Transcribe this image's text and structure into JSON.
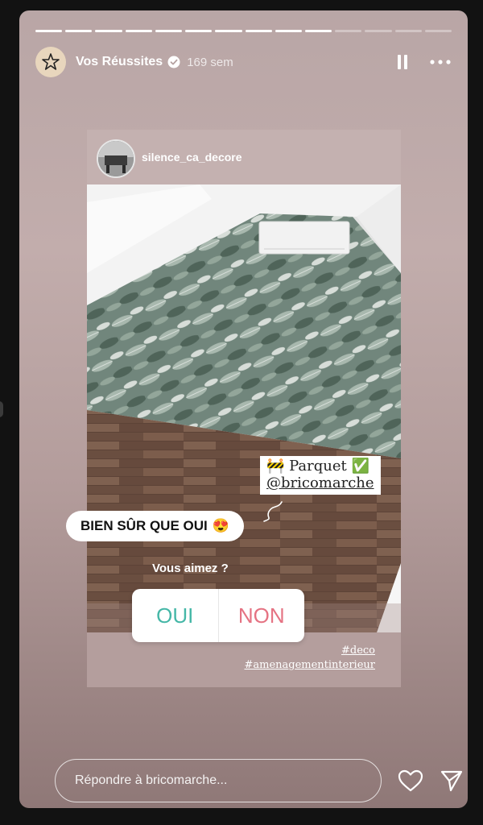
{
  "story": {
    "author": "Vos Réussites",
    "time_ago": "169 sem",
    "progress": {
      "segments": 14,
      "completed": 10
    }
  },
  "icons": {
    "avatar": "star-badge-icon",
    "verified": "verified-badge-icon",
    "pause": "pause-icon",
    "more": "more-options-icon",
    "heart": "heart-icon",
    "send": "send-icon"
  },
  "colors": {
    "poll_yes": "#45b7a7",
    "poll_no": "#e57383"
  },
  "repost": {
    "original_author": "silence_ca_decore",
    "sticker_parquet_line1": "🚧 Parquet ✅",
    "sticker_parquet_line2": "@bricomarche",
    "reply_bubble": "BIEN SÛR QUE OUI",
    "reply_emoji": "😍",
    "poll": {
      "question": "Vous aimez ?",
      "option_yes": "OUI",
      "option_no": "NON"
    },
    "hashtags": [
      "#deco",
      "#amenagementinterieur"
    ]
  },
  "reply_box": {
    "placeholder": "Répondre à bricomarche..."
  }
}
